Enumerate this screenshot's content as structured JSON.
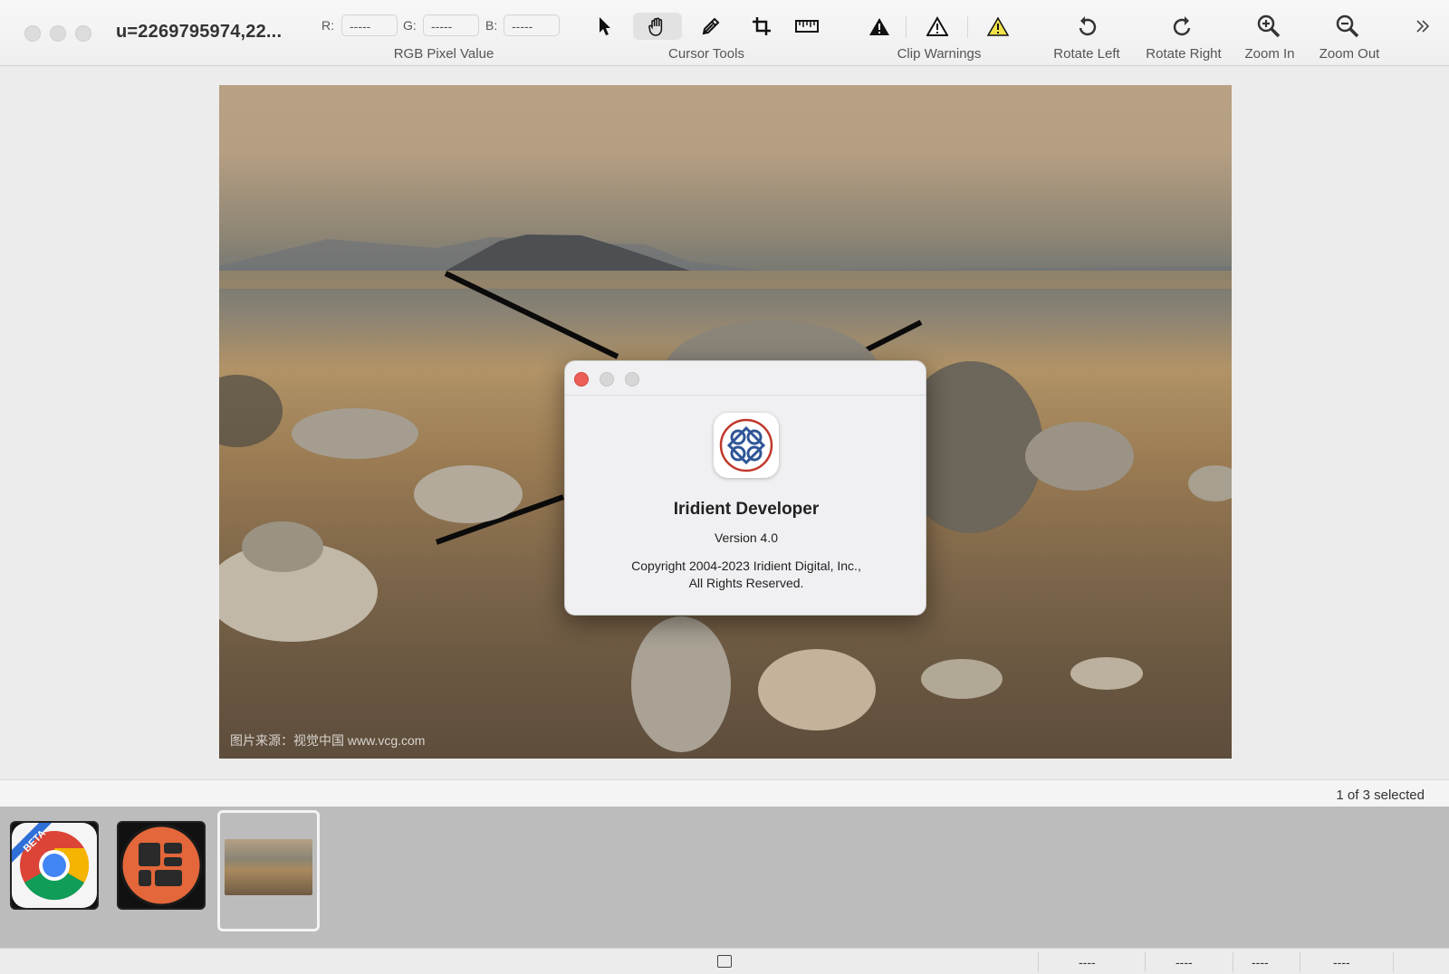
{
  "window": {
    "title": "u=2269795974,22..."
  },
  "toolbar": {
    "rgb": {
      "r_label": "R:",
      "r_value": "-----",
      "g_label": "G:",
      "g_value": "-----",
      "b_label": "B:",
      "b_value": "-----",
      "group_label": "RGB Pixel Value"
    },
    "cursor_tools": {
      "group_label": "Cursor Tools",
      "items": [
        "arrow-cursor-icon",
        "hand-tool-icon",
        "eyedropper-icon",
        "crop-icon",
        "ruler-icon"
      ],
      "selected": "hand-tool-icon"
    },
    "clip_warnings": {
      "group_label": "Clip Warnings",
      "items": [
        "black-clip-warning-icon",
        "white-clip-warning-icon",
        "yellow-clip-warning-icon"
      ]
    },
    "rotate_left_label": "Rotate Left",
    "rotate_right_label": "Rotate Right",
    "zoom_in_label": "Zoom In",
    "zoom_out_label": "Zoom Out",
    "overflow_icon": "chevron-double-right-icon"
  },
  "canvas": {
    "watermark": "图片来源：视觉中国 www.vcg.com"
  },
  "about_dialog": {
    "app_name": "Iridient Developer",
    "version": "Version 4.0",
    "copyright_line1": "Copyright 2004-2023 Iridient Digital, Inc.,",
    "copyright_line2": "All Rights Reserved."
  },
  "selection": {
    "status_text": "1 of 3 selected"
  },
  "filmstrip": {
    "thumbnails": [
      "chrome-beta-app-icon",
      "orange-grid-app-icon",
      "landscape-photo-thumbnail"
    ],
    "selected_index": 2
  },
  "statusbar": {
    "segments": [
      "----",
      "----",
      "----",
      "----"
    ]
  },
  "colors": {
    "accent_close": "#ec5f57",
    "toolbar_bg": "#f2f2f2",
    "filmstrip_bg": "#bcbcbc"
  }
}
